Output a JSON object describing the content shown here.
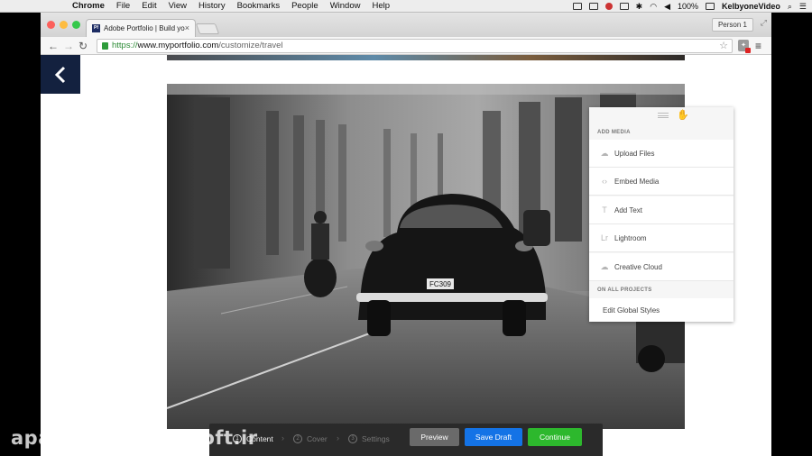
{
  "menubar": {
    "app_name": "Chrome",
    "items": [
      "File",
      "Edit",
      "View",
      "History",
      "Bookmarks",
      "People",
      "Window",
      "Help"
    ],
    "battery": "100%",
    "user": "KelbyoneVideo"
  },
  "browser": {
    "tab_title": "Adobe Portfolio | Build yo",
    "tab_favicon": "Pf",
    "tab_close": "×",
    "person": "Person 1",
    "url": {
      "scheme": "https://",
      "host": "www.myportfolio.com",
      "path": "/customize/travel"
    }
  },
  "media_panel": {
    "section_add_media": "ADD MEDIA",
    "items": [
      {
        "label": "Upload Files",
        "icon": "cloud-upload-icon",
        "glyph": "☁"
      },
      {
        "label": "Embed Media",
        "icon": "code-brackets-icon",
        "glyph": "‹›"
      },
      {
        "label": "Add Text",
        "icon": "text-icon",
        "glyph": "T"
      },
      {
        "label": "Lightroom",
        "icon": "lightroom-icon",
        "glyph": "Lr"
      },
      {
        "label": "Creative Cloud",
        "icon": "creative-cloud-icon",
        "glyph": "☁"
      }
    ],
    "section_all_projects": "ON ALL PROJECTS",
    "edit_global_styles": "Edit Global Styles"
  },
  "bottom_bar": {
    "steps": [
      {
        "num": "1",
        "label": "Content",
        "active": true
      },
      {
        "num": "2",
        "label": "Cover",
        "active": false
      },
      {
        "num": "3",
        "label": "Settings",
        "active": false
      }
    ],
    "preview_label": "Preview",
    "save_draft_label": "Save Draft",
    "continue_label": "Continue",
    "colors": {
      "preview": "#6a6a6a",
      "save_draft": "#1473e6",
      "continue": "#2db82d"
    }
  },
  "watermark": "aparat.com/farnsoft.ir",
  "photo": {
    "plate": "FC309"
  }
}
